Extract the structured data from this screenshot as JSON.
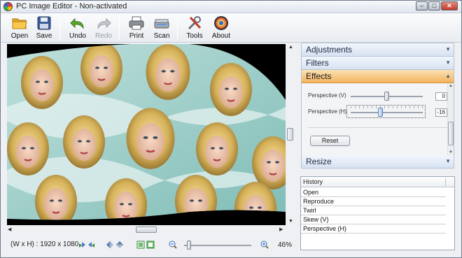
{
  "window": {
    "title": "PC Image Editor - Non-activated",
    "controls": {
      "minimize": "–",
      "maximize": "□",
      "close": "✕"
    }
  },
  "toolbar": {
    "open": "Open",
    "save": "Save",
    "undo": "Undo",
    "redo": "Redo",
    "print": "Print",
    "scan": "Scan",
    "tools": "Tools",
    "about": "About"
  },
  "canvas": {
    "image_description_icon": "photo-canvas"
  },
  "status": {
    "dimensions": "(W x H) : 1920 x 1080",
    "zoom": "46%",
    "zoom_level": 0.07
  },
  "panel": {
    "sections": {
      "adjustments": "Adjustments",
      "filters": "Filters",
      "effects": "Effects",
      "resize": "Resize"
    },
    "effects": {
      "perspective_v_label": "Perspective (V)",
      "perspective_v_value": "0",
      "perspective_v_level": 0.5,
      "perspective_h_label": "Perspective (H)",
      "perspective_h_value": "-16",
      "perspective_h_level": 0.42,
      "reset": "Reset"
    }
  },
  "history": {
    "header": "History",
    "items": [
      "Open",
      "Reproduce",
      "Twirl",
      "Skew (V)",
      "Perspective (H)"
    ]
  },
  "colors": {
    "active_section": "#f3b35d",
    "section_header": "#d7e2f1",
    "canvas_bg": "#000000"
  }
}
